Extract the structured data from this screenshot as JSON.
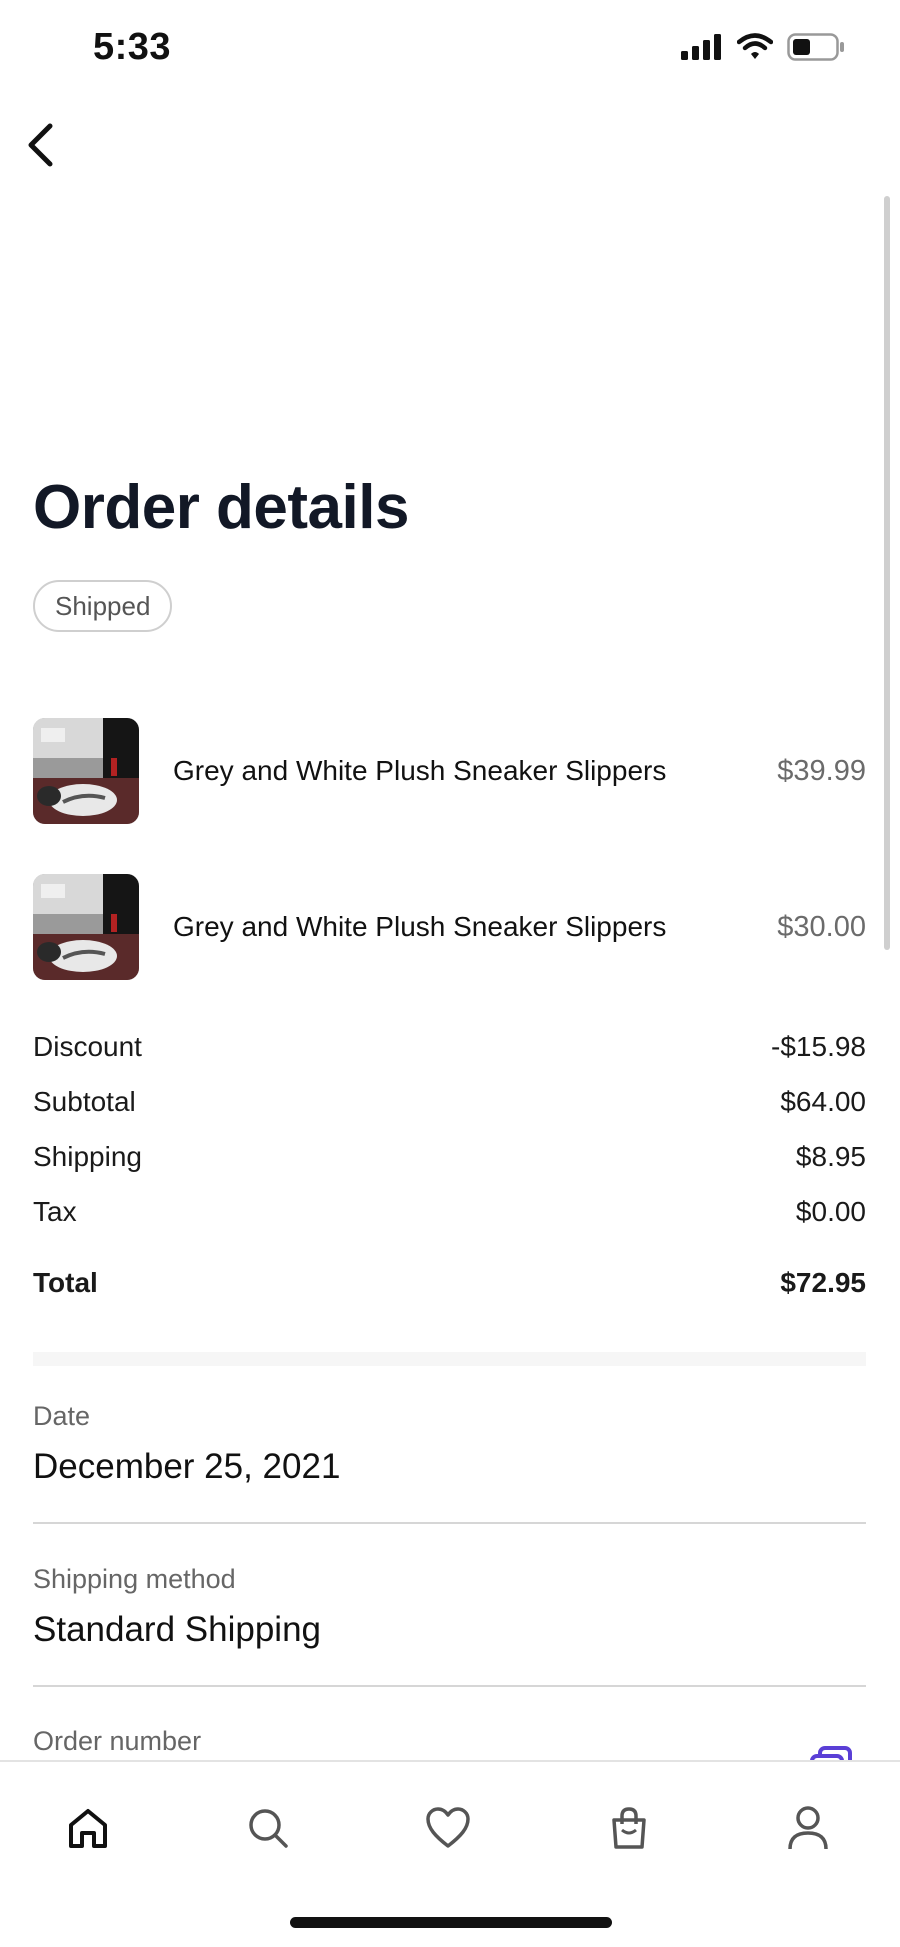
{
  "status_bar": {
    "time": "5:33"
  },
  "page": {
    "title": "Order details",
    "status": "Shipped"
  },
  "items": [
    {
      "name": "Grey and White Plush Sneaker Slippers",
      "price": "$39.99",
      "image": "sneaker-slippers-thumbnail"
    },
    {
      "name": "Grey and White Plush Sneaker Slippers",
      "price": "$30.00",
      "image": "sneaker-slippers-thumbnail"
    }
  ],
  "summary": [
    {
      "label": "Discount",
      "value": "-$15.98"
    },
    {
      "label": "Subtotal",
      "value": "$64.00"
    },
    {
      "label": "Shipping",
      "value": "$8.95"
    },
    {
      "label": "Tax",
      "value": "$0.00"
    }
  ],
  "total": {
    "label": "Total",
    "value": "$72.95"
  },
  "details": {
    "date_label": "Date",
    "date_value": "December 25, 2021",
    "method_label": "Shipping method",
    "method_value": "Standard Shipping",
    "order_label": "Order number"
  },
  "tabbar": {
    "items": [
      {
        "name": "home",
        "icon": "home-icon",
        "active": true
      },
      {
        "name": "search",
        "icon": "search-icon"
      },
      {
        "name": "favorites",
        "icon": "heart-icon"
      },
      {
        "name": "bag",
        "icon": "shopping-bag-icon"
      },
      {
        "name": "account",
        "icon": "profile-icon"
      }
    ]
  },
  "colors": {
    "accent": "#5a3fd6",
    "title": "#121826"
  }
}
